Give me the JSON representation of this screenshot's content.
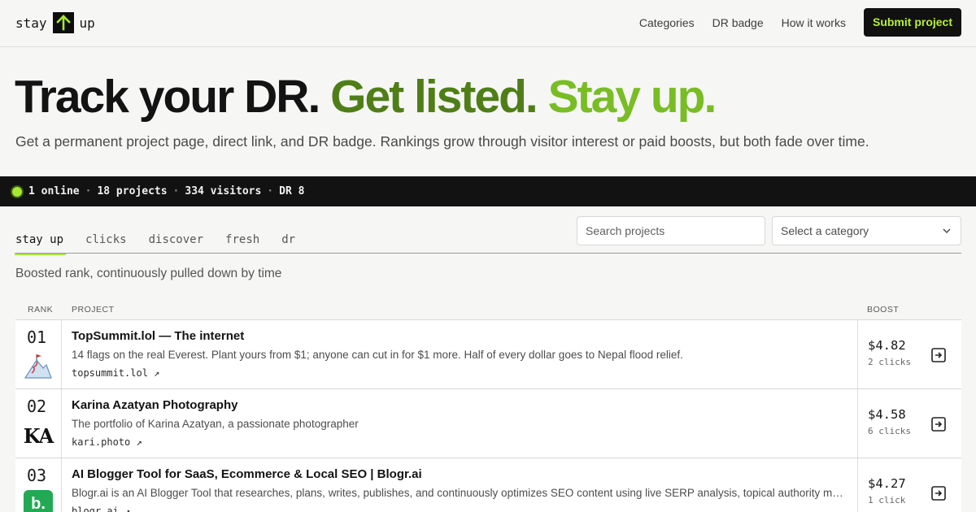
{
  "header": {
    "logo_left": "stay",
    "logo_right": "up",
    "nav": [
      "Categories",
      "DR badge",
      "How it works"
    ],
    "cta": "Submit project"
  },
  "hero": {
    "title_part1": "Track your DR.",
    "title_part2": "Get listed.",
    "title_part3": "Stay up.",
    "subtitle": "Get a permanent project page, direct link, and DR badge. Rankings grow through visitor interest or paid boosts, but both fade over time."
  },
  "stats": {
    "online": "1 online",
    "projects": "18 projects",
    "visitors": "334 visitors",
    "dr": "DR 8",
    "separator": "·"
  },
  "tabs": [
    "stay up",
    "clicks",
    "discover",
    "fresh",
    "dr"
  ],
  "active_tab": "stay up",
  "search": {
    "placeholder": "Search projects"
  },
  "category_select": {
    "value": "Select a category"
  },
  "tab_description": "Boosted rank, continuously pulled down by time",
  "table": {
    "headers": {
      "rank": "RANK",
      "project": "PROJECT",
      "boost": "BOOST"
    },
    "rows": [
      {
        "rank": "01",
        "title": "TopSummit.lol — The internet",
        "description": "14 flags on the real Everest. Plant yours from $1; anyone can cut in for $1 more. Half of every dollar goes to Nepal flood relief.",
        "link": "topsummit.lol ↗",
        "amount": "$4.82",
        "clicks": "2 clicks",
        "logo": "mountain-flag-icon"
      },
      {
        "rank": "02",
        "title": "Karina Azatyan Photography",
        "description": "The portfolio of Karina Azatyan, a passionate photographer",
        "link": "kari.photo ↗",
        "amount": "$4.58",
        "clicks": "6 clicks",
        "logo_text": "KA"
      },
      {
        "rank": "03",
        "title": "AI Blogger Tool for SaaS, Ecommerce & Local SEO | Blogr.ai",
        "description": "Blogr.ai is an AI Blogger Tool that researches, plans, writes, publishes, and continuously optimizes SEO content using live SERP analysis, topical authority mapping, and internal linking.",
        "link": "blogr.ai ↗",
        "amount": "$4.27",
        "clicks": "1 click",
        "logo_text": "b."
      }
    ]
  },
  "colors": {
    "accent": "#a6e832",
    "hero_mid_green": "#4f7e17",
    "hero_bright_green": "#79bd25",
    "dark": "#121212"
  }
}
